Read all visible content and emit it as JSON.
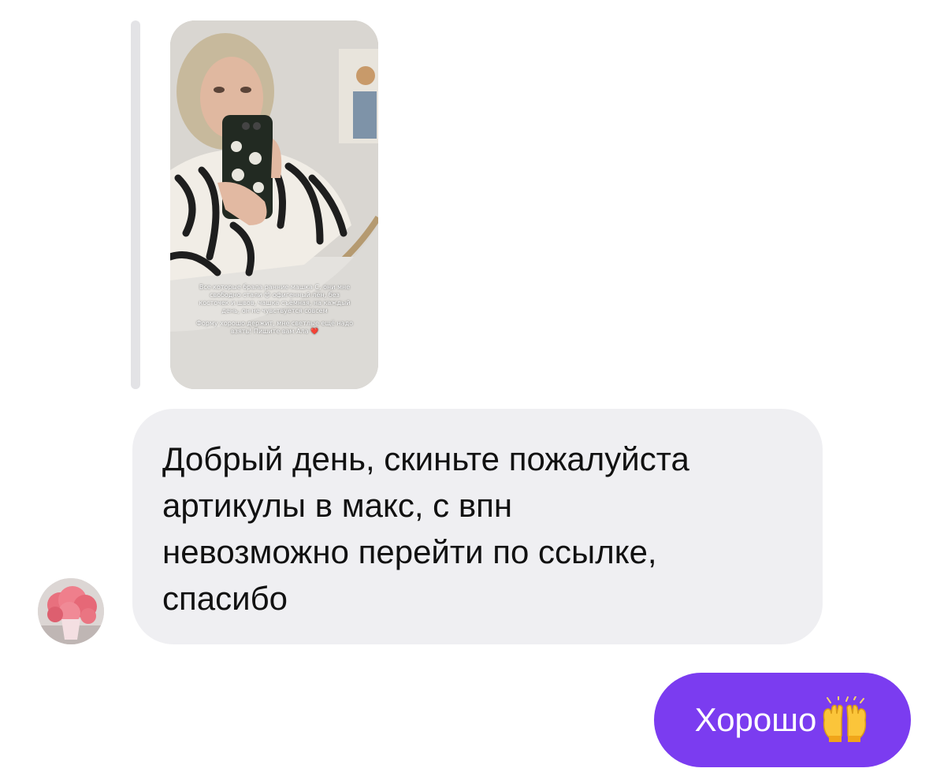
{
  "conversation": {
    "story_reply": {
      "caption_line_1": "Все которые брала ранние машка С, они мне свободно стали 😍 офигенный лён, без косточек и швов, чашка съёмная, на каждый день, он не чувствуется совсем",
      "caption_line_2": "Форму хорошо держит, мне светлые ещё надо взять! Пишите вам Ала ❤️"
    },
    "incoming_message": {
      "lines": [
        "Добрый день, скиньте пожалуйста",
        "артикулы в макс, с впн",
        "невозможно перейти по ссылке,",
        "спасибо"
      ]
    },
    "outgoing_message": {
      "text": "Хорошо",
      "emoji_icon": "raising-hands-icon"
    }
  },
  "colors": {
    "incoming_bubble": "#efeff2",
    "outgoing_bubble": "#7b3cf0",
    "reply_bar": "#e3e3e6"
  }
}
